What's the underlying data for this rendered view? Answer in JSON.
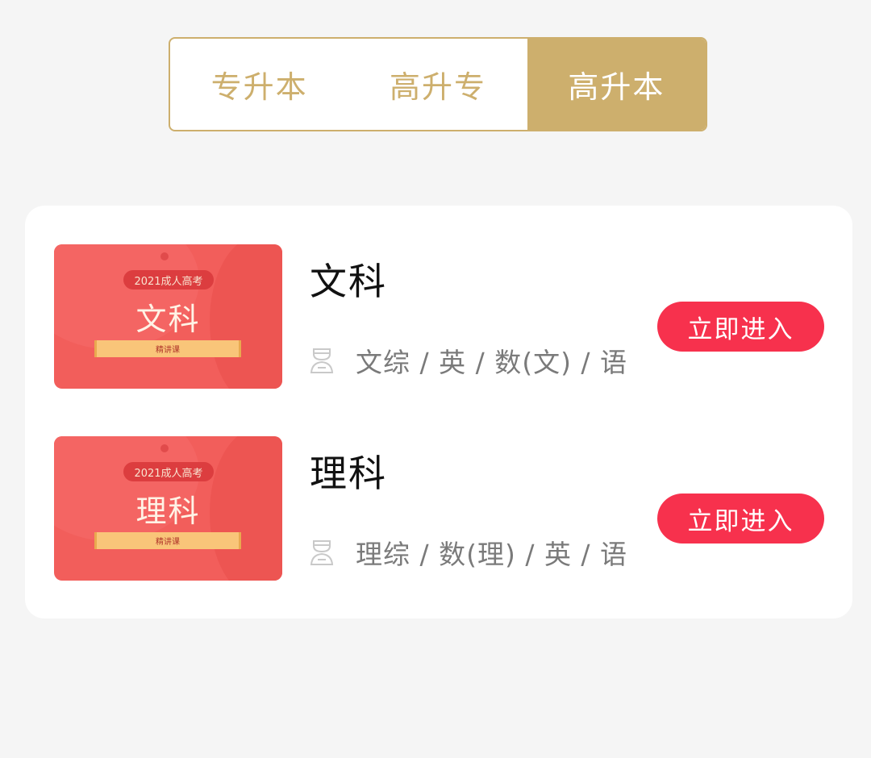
{
  "tabs": [
    {
      "label": "专升本"
    },
    {
      "label": "高升专"
    },
    {
      "label": "高升本"
    }
  ],
  "active_tab": "高升本",
  "colors": {
    "accent_gold": "#cdaf6d",
    "button_red": "#f7314d",
    "thumb_red": "#f25e5b"
  },
  "courses": [
    {
      "thumb_badge": "2021成人高考",
      "thumb_title": "文科",
      "thumb_banner": "精讲课",
      "title": "文科",
      "subjects": "文综 / 英 / 数(文) / 语",
      "subjects_icon": "student-icon",
      "button_label": "立即进入"
    },
    {
      "thumb_badge": "2021成人高考",
      "thumb_title": "理科",
      "thumb_banner": "精讲课",
      "title": "理科",
      "subjects": "理综 / 数(理) / 英 / 语",
      "subjects_icon": "student-icon",
      "button_label": "立即进入"
    }
  ]
}
